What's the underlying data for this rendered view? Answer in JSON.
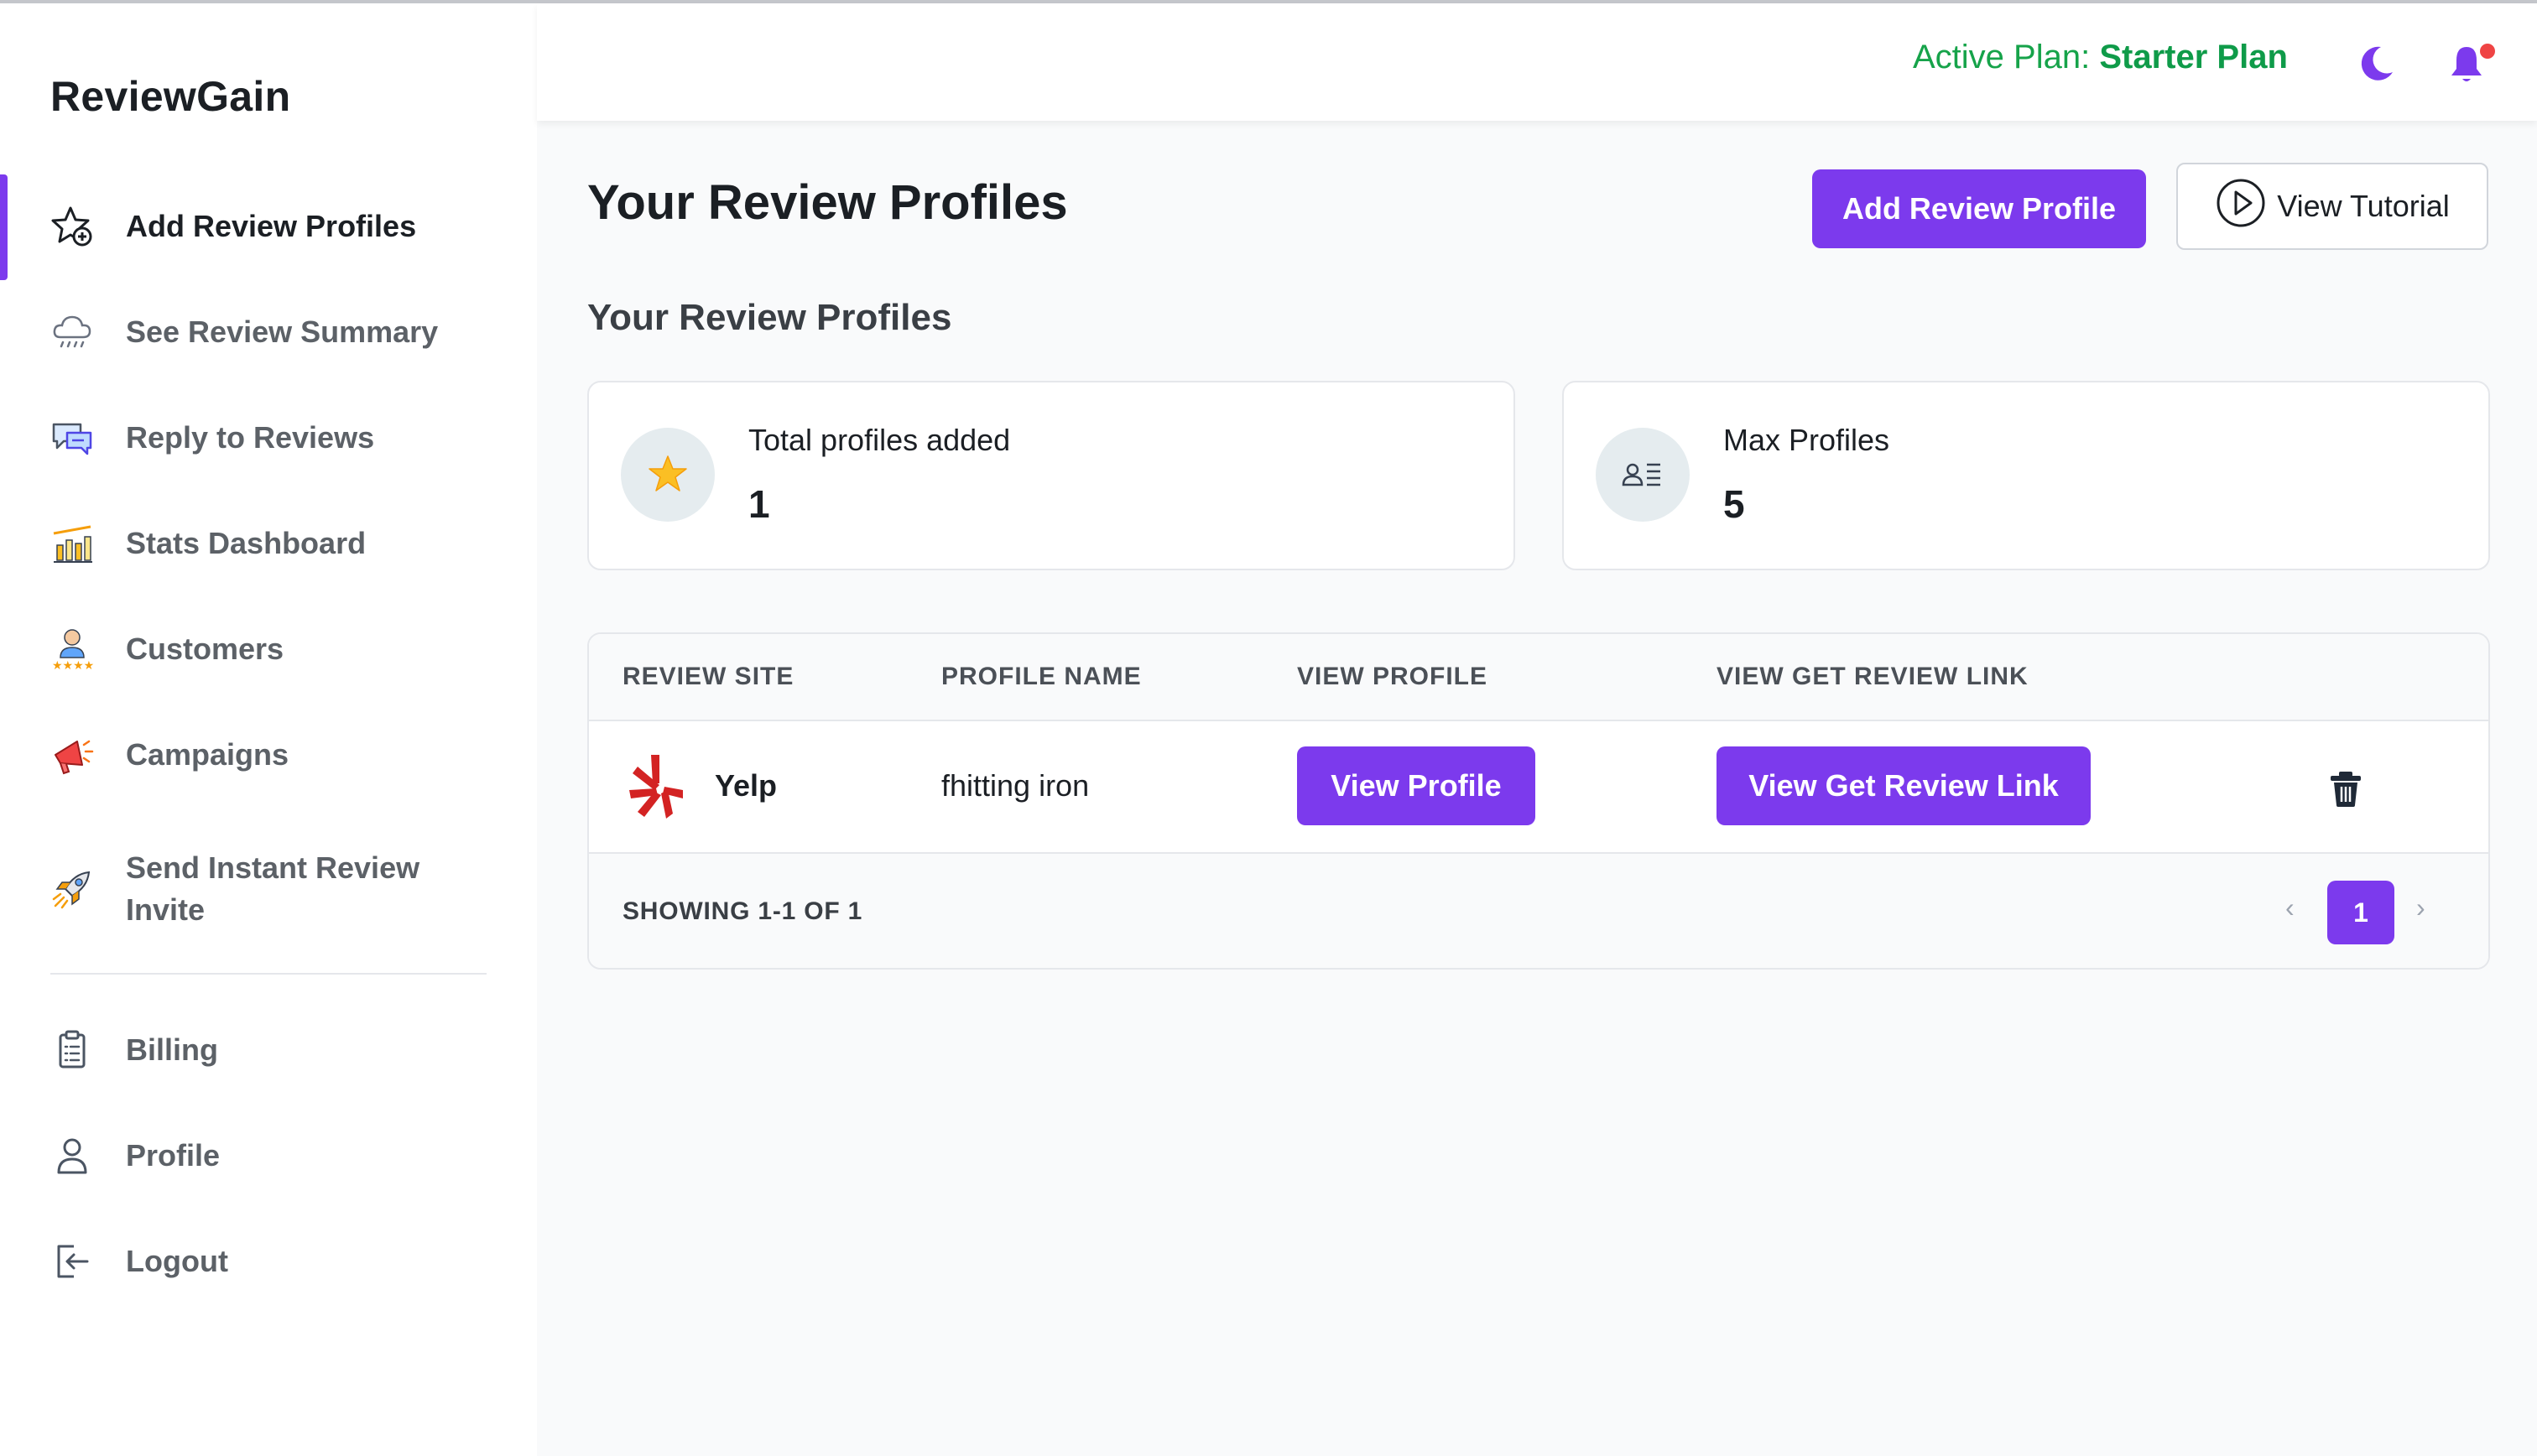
{
  "app": {
    "name": "ReviewGain"
  },
  "sidebar": {
    "items": [
      {
        "label": "Add Review Profiles",
        "icon": "star-plus-icon",
        "active": true
      },
      {
        "label": "See Review Summary",
        "icon": "cloud-rain-icon"
      },
      {
        "label": "Reply to Reviews",
        "icon": "chat-bubbles-icon"
      },
      {
        "label": "Stats Dashboard",
        "icon": "bar-chart-icon"
      },
      {
        "label": "Customers",
        "icon": "customer-stars-icon"
      },
      {
        "label": "Campaigns",
        "icon": "megaphone-icon"
      },
      {
        "label": "Send Instant Review Invite",
        "icon": "rocket-icon"
      },
      {
        "label": "Billing",
        "icon": "clipboard-icon"
      },
      {
        "label": "Profile",
        "icon": "user-icon"
      },
      {
        "label": "Logout",
        "icon": "logout-icon"
      }
    ]
  },
  "header": {
    "plan_label": "Active Plan:",
    "plan_name": "Starter Plan"
  },
  "page": {
    "title": "Your Review Profiles",
    "add_button": "Add Review Profile",
    "tutorial_button": "View Tutorial",
    "section_title": "Your Review Profiles"
  },
  "stats": {
    "total": {
      "label": "Total profiles added",
      "value": "1",
      "icon": "star-icon"
    },
    "max": {
      "label": "Max Profiles",
      "value": "5",
      "icon": "profile-list-icon"
    }
  },
  "table": {
    "headers": [
      "REVIEW SITE",
      "PROFILE NAME",
      "VIEW PROFILE",
      "VIEW GET REVIEW LINK"
    ],
    "rows": [
      {
        "site": "Yelp",
        "profile_name": "fhitting iron",
        "view_profile": "View Profile",
        "view_link": "View Get Review Link"
      }
    ],
    "footer": "SHOWING 1-1 OF 1",
    "pagination": {
      "prev": "‹",
      "current": "1",
      "next": "›"
    }
  },
  "colors": {
    "accent": "#7c3aed",
    "plan_green": "#16a34a",
    "notification_dot": "#ef4444",
    "yelp_red": "#d32323"
  }
}
